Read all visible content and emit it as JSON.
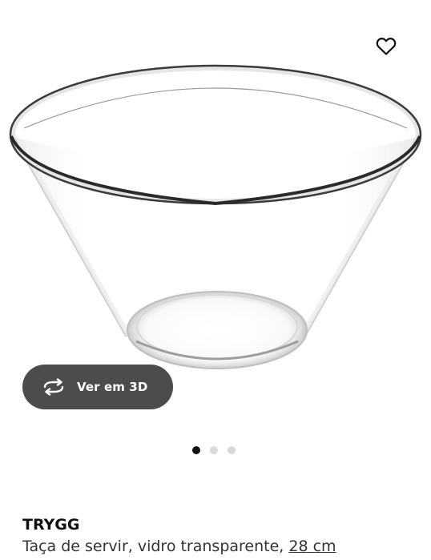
{
  "product": {
    "name": "TRYGG",
    "description": "Taça de servir, vidro transparente, ",
    "size_link": "28 cm",
    "image_icon": "glass-bowl-image"
  },
  "actions": {
    "view_3d_label": "Ver em 3D",
    "view_3d_icon": "rotate-3d-icon",
    "favorite_icon": "heart-icon"
  },
  "carousel": {
    "dots": 3,
    "active": 1
  },
  "colors": {
    "button_bg": "#4c4c4c",
    "dot_active": "#111111",
    "dot_inactive": "#d9d9d9"
  }
}
